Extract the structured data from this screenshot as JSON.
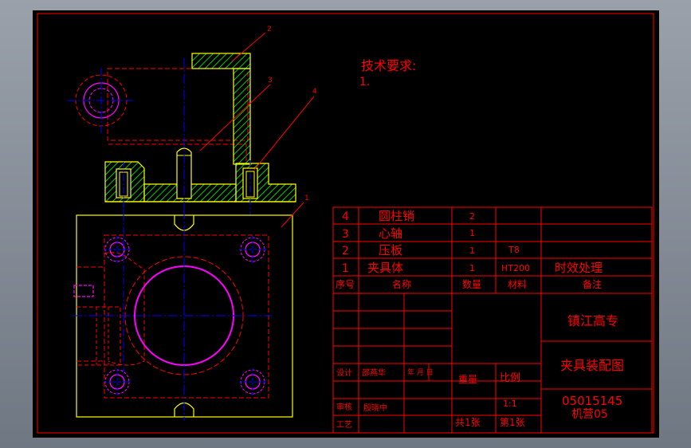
{
  "tech_requirements": {
    "title": "技术要求:",
    "item1": "1."
  },
  "balloons": [
    "2",
    "3",
    "4",
    "1"
  ],
  "parts_list": [
    {
      "no": "4",
      "name": "圆柱销",
      "qty": "2",
      "material": "",
      "note": ""
    },
    {
      "no": "3",
      "name": "心轴",
      "qty": "1",
      "material": "",
      "note": ""
    },
    {
      "no": "2",
      "name": "压板",
      "qty": "1",
      "material": "T8",
      "note": ""
    },
    {
      "no": "1",
      "name": "夹具体",
      "qty": "1",
      "material": "HT200",
      "note": "时效处理"
    }
  ],
  "parts_header": {
    "no": "序号",
    "name": "名称",
    "qty": "数量",
    "material": "材料",
    "note": "备注"
  },
  "title_block": {
    "school": "镇江高专",
    "drawing_title": "夹具装配图",
    "code": "05015145",
    "class": "机营05",
    "design_label": "设计",
    "designer": "邵燕华",
    "date_label": "年 月 日",
    "check_label": "审核",
    "checker": "殷晓中",
    "process_label": "工艺",
    "weight_label": "重量",
    "scale_label": "比例",
    "scale_value": "1:1",
    "sheets_total": "共1张",
    "sheet_no": "第1张"
  },
  "colors": {
    "background": "#000000",
    "frame": "#ff0000",
    "outline": "#ffff00",
    "hatch": "#00ff00",
    "centerline": "#0000ff",
    "hidden": "#ff0000",
    "magenta": "#ff00ff",
    "leader": "#ff0000"
  }
}
